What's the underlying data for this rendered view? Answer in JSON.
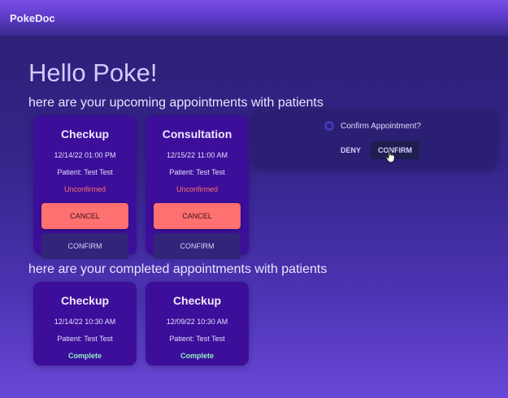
{
  "app": {
    "brand": "PokeDoc"
  },
  "greeting": "Hello Poke!",
  "upcoming": {
    "heading": "here are your upcoming appointments with patients",
    "cards": [
      {
        "title": "Checkup",
        "datetime": "12/14/22 01:00 PM",
        "patient": "Patient: Test Test",
        "status": "Unconfirmed",
        "cancel_label": "CANCEL",
        "confirm_label": "CONFIRM"
      },
      {
        "title": "Consultation",
        "datetime": "12/15/22 11:00 AM",
        "patient": "Patient: Test Test",
        "status": "Unconfirmed",
        "cancel_label": "CANCEL",
        "confirm_label": "CONFIRM"
      }
    ]
  },
  "completed": {
    "heading": "here are your completed appointments with patients",
    "cards": [
      {
        "title": "Checkup",
        "datetime": "12/14/22 10:30 AM",
        "patient": "Patient: Test Test",
        "status": "Complete"
      },
      {
        "title": "Checkup",
        "datetime": "12/09/22 10:30 AM",
        "patient": "Patient: Test Test",
        "status": "Complete"
      }
    ]
  },
  "popover": {
    "question": "Confirm Appointment?",
    "deny_label": "DENY",
    "confirm_label": "CONFIRM",
    "icon": "info-icon"
  },
  "colors": {
    "card_bg": "#3c0e99",
    "cancel_bg": "#ff7070",
    "unconfirmed_text": "#ff6f6f",
    "complete_text": "#8ff0c6"
  }
}
